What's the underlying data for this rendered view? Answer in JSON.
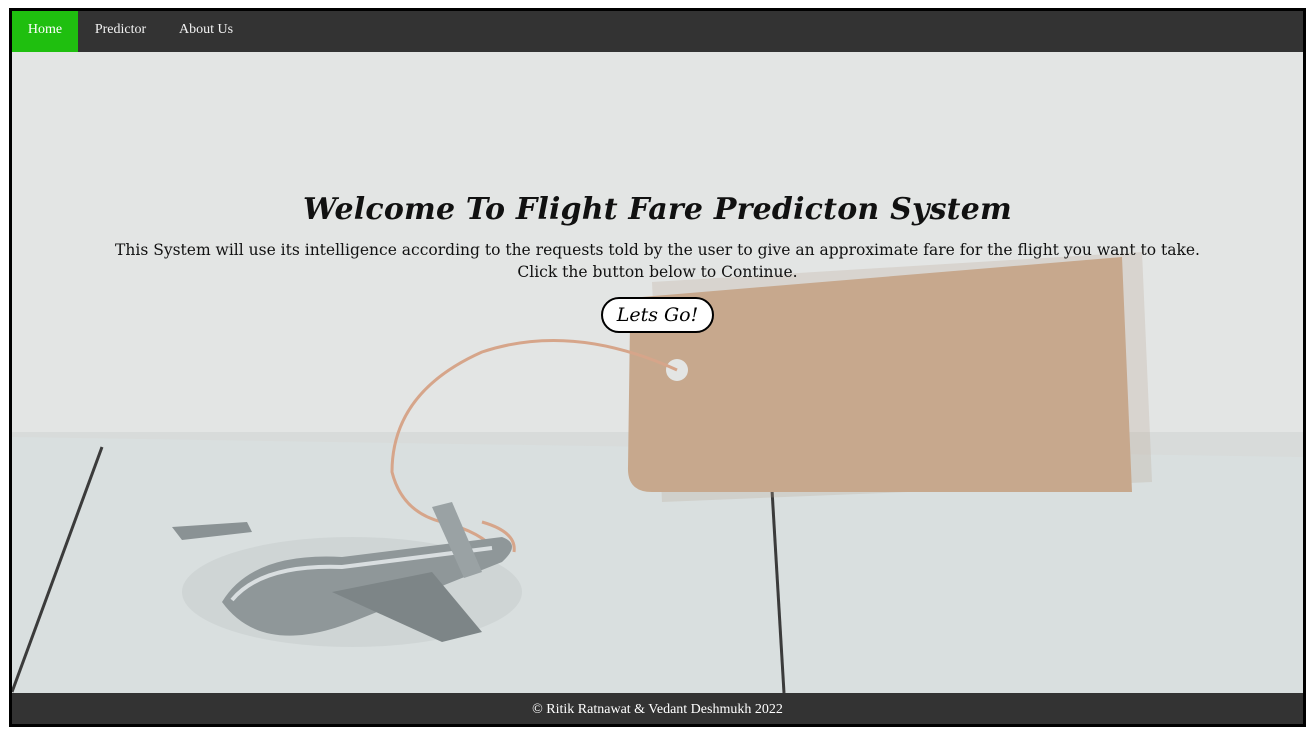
{
  "nav": {
    "items": [
      {
        "label": "Home",
        "active": true
      },
      {
        "label": "Predictor"
      },
      {
        "label": "About Us"
      }
    ],
    "active_color": "#1fbf0f",
    "bar_color": "#333333"
  },
  "hero": {
    "title": "Welcome To Flight Fare Predicton System",
    "description_line1": "This System will use its intelligence according to the requests told by the user to give an approximate fare for the flight you want to take.",
    "description_line2": "Click the button below to Continue.",
    "cta_label": "Lets Go!"
  },
  "footer": {
    "text": "© Ritik Ratnawat & Vedant Deshmukh 2022"
  }
}
